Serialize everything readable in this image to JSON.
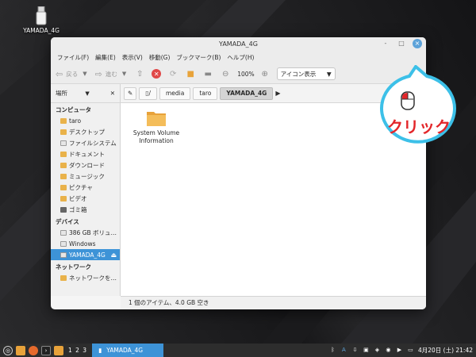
{
  "desktop": {
    "usb_icon_label": "YAMADA_4G"
  },
  "window": {
    "title": "YAMADA_4G",
    "buttons": {
      "minimize": "-",
      "maximize": "□",
      "close": "×"
    }
  },
  "menubar": {
    "items": [
      "ファイル(F)",
      "編集(E)",
      "表示(V)",
      "移動(G)",
      "ブックマーク(B)",
      "ヘルプ(H)"
    ]
  },
  "toolbar": {
    "back_label": "戻る",
    "forward_label": "進む",
    "zoom": "100%",
    "view_mode": "アイコン表示"
  },
  "sidebar": {
    "header_label": "場所",
    "sections": {
      "computer": "コンピュータ",
      "devices": "デバイス",
      "network": "ネットワーク"
    },
    "computer_items": [
      "taro",
      "デスクトップ",
      "ファイルシステム",
      "ドキュメント",
      "ダウンロード",
      "ミュージック",
      "ピクチャ",
      "ビデオ",
      "ゴミ箱"
    ],
    "device_items": [
      "386 GB ボリュ…",
      "Windows",
      "YAMADA_4G"
    ],
    "network_items": [
      "ネットワークを…"
    ]
  },
  "pathbar": {
    "root": "/",
    "segments": [
      "media",
      "taro",
      "YAMADA_4G"
    ]
  },
  "files": [
    {
      "name": "System Volume Information"
    }
  ],
  "status": "1 個のアイテム、4.0 GB 空き",
  "callout": {
    "label": "クリック"
  },
  "taskbar": {
    "workspaces": "1 2 3",
    "window_label": "YAMADA_4G",
    "clock": "4月20日 (土) 21:42"
  },
  "colors": {
    "accent": "#3d93d7",
    "callout_border": "#3cc0e8",
    "callout_text": "#e3262a",
    "close_button": "#5ea3d9",
    "stop": "#e04848"
  }
}
